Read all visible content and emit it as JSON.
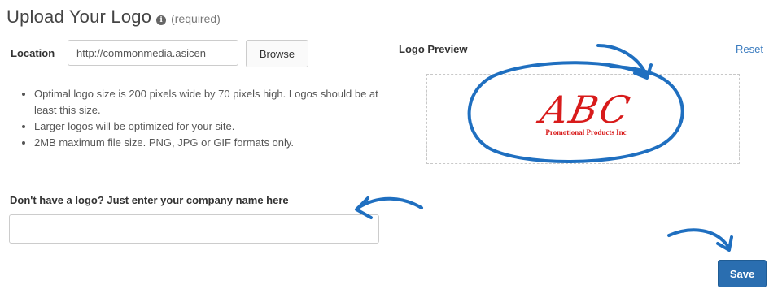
{
  "header": {
    "title": "Upload Your Logo",
    "info_icon": "info-circle-icon",
    "required_note": "(required)"
  },
  "location": {
    "label": "Location",
    "value": "http://commonmedia.asicen",
    "browse_label": "Browse"
  },
  "tips": [
    "Optimal logo size is 200 pixels wide by 70 pixels high. Logos should be at least this size.",
    "Larger logos will be optimized for your site.",
    "2MB maximum file size. PNG, JPG or GIF formats only."
  ],
  "company": {
    "label": "Don't have a logo? Just enter your company name here",
    "value": ""
  },
  "preview": {
    "label": "Logo Preview",
    "reset_label": "Reset",
    "logo_text": "ABC",
    "logo_tagline": "Promotional Products Inc"
  },
  "actions": {
    "save_label": "Save"
  },
  "colors": {
    "link": "#3a7bbf",
    "save_button": "#2a6eb0",
    "annotation": "#1f6fc0",
    "logo_red": "#d81b1b"
  }
}
